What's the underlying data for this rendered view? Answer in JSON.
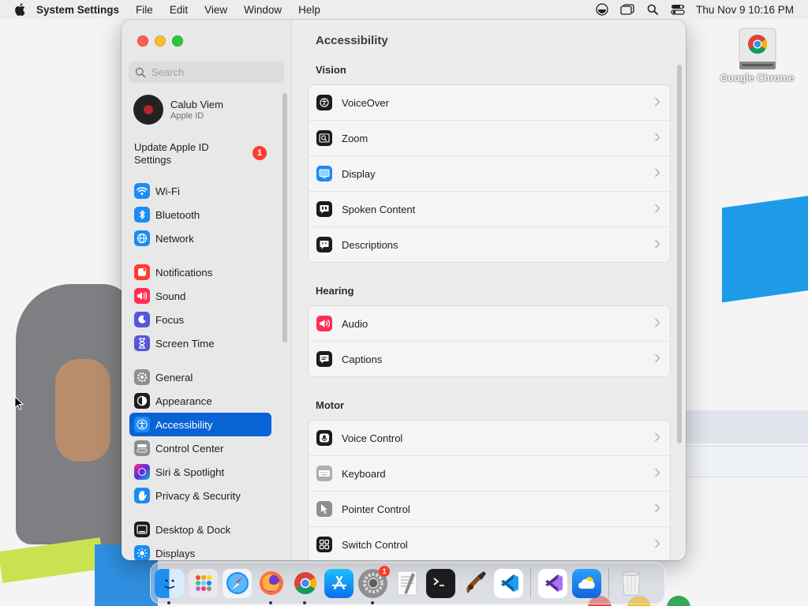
{
  "menubar": {
    "app_name": "System Settings",
    "menus": [
      "File",
      "Edit",
      "View",
      "Window",
      "Help"
    ],
    "clock": "Thu Nov 9  10:16 PM",
    "status_icons": [
      "accessibility-status-icon",
      "stage-manager-icon",
      "spotlight-search-icon",
      "control-center-icon"
    ]
  },
  "desktop": {
    "icon_label": "Google Chrome"
  },
  "window": {
    "search_placeholder": "Search",
    "profile": {
      "name": "Calub Viem",
      "subtitle": "Apple ID"
    },
    "update": {
      "label": "Update Apple ID Settings",
      "badge": "1"
    },
    "sidebar_groups": [
      [
        {
          "label": "Wi-Fi",
          "icon": "wifi-icon",
          "color": "#1a8cf4"
        },
        {
          "label": "Bluetooth",
          "icon": "bluetooth-icon",
          "color": "#1a8cf4"
        },
        {
          "label": "Network",
          "icon": "network-globe-icon",
          "color": "#1a8cf4"
        }
      ],
      [
        {
          "label": "Notifications",
          "icon": "notifications-icon",
          "color": "#ff3b30"
        },
        {
          "label": "Sound",
          "icon": "sound-icon",
          "color": "#ff2d55"
        },
        {
          "label": "Focus",
          "icon": "focus-moon-icon",
          "color": "#5856d6"
        },
        {
          "label": "Screen Time",
          "icon": "hourglass-icon",
          "color": "#5856d6"
        }
      ],
      [
        {
          "label": "General",
          "icon": "general-gear-icon",
          "color": "#8e8e93"
        },
        {
          "label": "Appearance",
          "icon": "appearance-icon",
          "color": "#1c1c1e"
        },
        {
          "label": "Accessibility",
          "icon": "accessibility-icon",
          "color": "#1a8cf4",
          "selected": true
        },
        {
          "label": "Control Center",
          "icon": "control-center-icon",
          "color": "#8e8e93"
        },
        {
          "label": "Siri & Spotlight",
          "icon": "siri-icon",
          "color": "#a23cd6"
        },
        {
          "label": "Privacy & Security",
          "icon": "privacy-hand-icon",
          "color": "#1a8cf4"
        }
      ],
      [
        {
          "label": "Desktop & Dock",
          "icon": "desktop-dock-icon",
          "color": "#1c1c1e"
        },
        {
          "label": "Displays",
          "icon": "displays-icon",
          "color": "#1a8cf4"
        }
      ]
    ],
    "main": {
      "title": "Accessibility",
      "sections": [
        {
          "title": "Vision",
          "items": [
            {
              "label": "VoiceOver",
              "icon": "voiceover-icon",
              "color": "#1c1c1e"
            },
            {
              "label": "Zoom",
              "icon": "zoom-icon",
              "color": "#1c1c1e"
            },
            {
              "label": "Display",
              "icon": "display-icon",
              "color": "#1a8cf4"
            },
            {
              "label": "Spoken Content",
              "icon": "spoken-content-icon",
              "color": "#1c1c1e"
            },
            {
              "label": "Descriptions",
              "icon": "descriptions-icon",
              "color": "#1c1c1e"
            }
          ]
        },
        {
          "title": "Hearing",
          "items": [
            {
              "label": "Audio",
              "icon": "audio-icon",
              "color": "#ff2d55"
            },
            {
              "label": "Captions",
              "icon": "captions-icon",
              "color": "#1c1c1e"
            }
          ]
        },
        {
          "title": "Motor",
          "items": [
            {
              "label": "Voice Control",
              "icon": "voice-control-icon",
              "color": "#1c1c1e"
            },
            {
              "label": "Keyboard",
              "icon": "keyboard-icon",
              "color": "#aeaeb2"
            },
            {
              "label": "Pointer Control",
              "icon": "pointer-control-icon",
              "color": "#8e8e93"
            },
            {
              "label": "Switch Control",
              "icon": "switch-control-icon",
              "color": "#1c1c1e"
            }
          ]
        }
      ]
    }
  },
  "dock": {
    "apps": [
      {
        "name": "finder-icon",
        "color": "#1f8cf0",
        "running": true
      },
      {
        "name": "launchpad-icon",
        "color": "#e8e8ea"
      },
      {
        "name": "safari-icon",
        "color": "#1a8cf4"
      },
      {
        "name": "firefox-icon",
        "color": "#6c3bd1",
        "running": true
      },
      {
        "name": "chrome-icon",
        "color": "#ffffff",
        "running": true
      },
      {
        "name": "app-store-icon",
        "color": "#1a8cf4"
      },
      {
        "name": "system-settings-icon",
        "color": "#8e8e93",
        "running": true,
        "badge": "1"
      },
      {
        "name": "textedit-icon",
        "color": "#f5f5f5"
      },
      {
        "name": "terminal-icon",
        "color": "#1c1c1e"
      },
      {
        "name": "instruments-icon",
        "color": "#3a2a1f"
      },
      {
        "name": "vscode-icon",
        "color": "#ffffff"
      }
    ],
    "recent_apps": [
      {
        "name": "visual-studio-icon",
        "color": "#ffffff"
      },
      {
        "name": "weather-icon",
        "color": "#2a8cf0"
      }
    ],
    "trash": {
      "name": "trash-icon",
      "color": "#e0e0e0"
    }
  }
}
